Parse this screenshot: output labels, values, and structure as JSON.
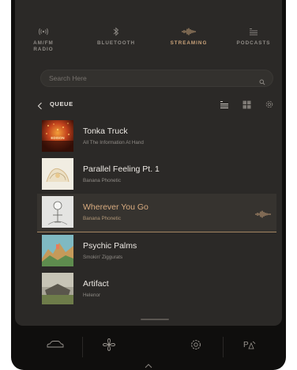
{
  "sources": [
    {
      "label": "AM/FM\nRADIO",
      "icon": "radio-waves-icon",
      "active": false
    },
    {
      "label": "BLUETOOTH",
      "icon": "bluetooth-icon",
      "active": false
    },
    {
      "label": "STREAMING",
      "icon": "streaming-waveform-icon",
      "active": true
    },
    {
      "label": "PODCASTS",
      "icon": "podcast-list-icon",
      "active": false
    }
  ],
  "search": {
    "placeholder": "Search Here"
  },
  "queue": {
    "title": "QUEUE"
  },
  "tracks": [
    {
      "title": "Tonka Truck",
      "artist": "All The Information At Hand",
      "art_text": "EDISON"
    },
    {
      "title": "Parallel Feeling Pt. 1",
      "artist": "Banana Phonetic"
    },
    {
      "title": "Wherever You Go",
      "artist": "Banana Phonetic",
      "playing": true
    },
    {
      "title": "Psychic Palms",
      "artist": "Smokin' Ziggurats"
    },
    {
      "title": "Artifact",
      "artist": "Helenor"
    }
  ],
  "colors": {
    "accent": "#c9a27a",
    "background": "#2b2927",
    "dock": "#0f0e0d"
  }
}
